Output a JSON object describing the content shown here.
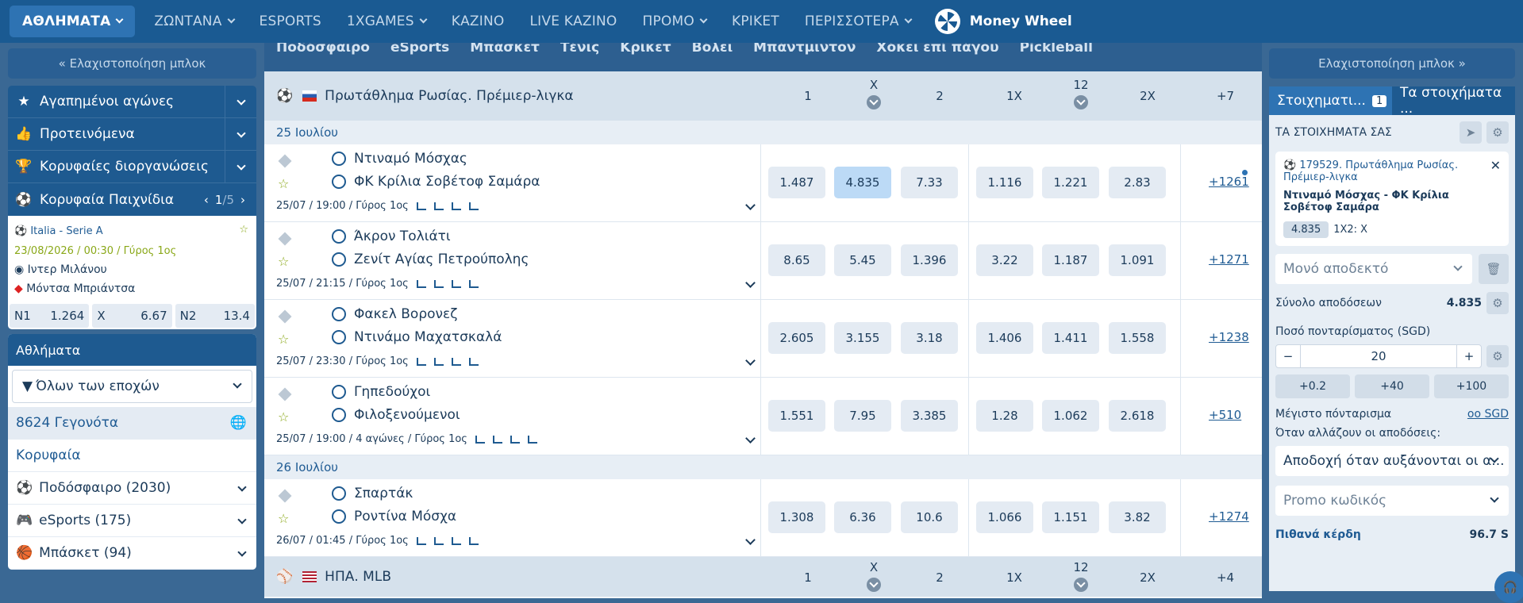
{
  "topnav": {
    "items": [
      {
        "label": "ΑΘΛΗΜΑΤΑ",
        "caret": true,
        "active": true
      },
      {
        "label": "ΖΩΝΤΑΝΑ",
        "caret": true
      },
      {
        "label": "ESPORTS"
      },
      {
        "label": "1XGAMES",
        "caret": true
      },
      {
        "label": "ΚΑΖΙΝΟ"
      },
      {
        "label": "LIVE ΚΑΖΙΝΟ"
      },
      {
        "label": "ΠΡΟΜΟ",
        "caret": true
      },
      {
        "label": "ΚΡΙΚΕΤ"
      },
      {
        "label": "ΠΕΡΙΣΣΟΤΕΡΑ",
        "caret": true
      }
    ],
    "money_wheel": "Money Wheel"
  },
  "left": {
    "minimize": "« Ελαχιστοποίηση μπλοκ",
    "nav": [
      {
        "label": "Αγαπημένοι αγώνες",
        "icon": "star-icon"
      },
      {
        "label": "Προτεινόμενα",
        "icon": "thumbs-up-icon"
      },
      {
        "label": "Κορυφαίες διοργανώσεις",
        "icon": "trophy-icon"
      }
    ],
    "top_games": {
      "label": "Κορυφαία Παιχνίδια",
      "page": "1",
      "pages": "/5"
    },
    "top_game": {
      "league": "Italia - Serie A",
      "datetime": "23/08/2026 / 00:30 / Γύρος 1ος",
      "team1": "Ιντερ Μιλάνου",
      "team2": "Μόντσα Μπριάντσα",
      "odds": [
        {
          "label": "N1",
          "value": "1.264"
        },
        {
          "label": "X",
          "value": "6.67"
        },
        {
          "label": "N2",
          "value": "13.4"
        }
      ]
    },
    "sports": {
      "header": "Αθλήματα",
      "season_select": "Όλων των εποχών",
      "events": "8624 Γεγονότα",
      "top": "Κορυφαία",
      "items": [
        {
          "label": "Ποδόσφαιρο (2030)",
          "icon": "soccer-icon"
        },
        {
          "label": "eSports (175)",
          "icon": "gamepad-icon"
        },
        {
          "label": "Μπάσκετ (94)",
          "icon": "basketball-icon"
        }
      ]
    }
  },
  "center": {
    "subnav": [
      "Ποδόσφαιρο",
      "eSports",
      "Μπάσκετ",
      "Τένις",
      "Κρίκετ",
      "Βόλεϊ",
      "Μπάντμιντον",
      "Χόκεϊ επί πάγου",
      "Pickleball"
    ],
    "league1": "Πρωτάθλημα Ρωσίας. Πρέμιερ-λιγκα",
    "league2": "ΗΠΑ. MLB",
    "columns": [
      "1",
      "X",
      "2",
      "1X",
      "12",
      "2X"
    ],
    "league1_more": "+7",
    "league2_more": "+4",
    "date1": "25 Ιουλίου",
    "date2": "26 Ιουλίου",
    "matches": [
      {
        "team1": "Ντιναμό Μόσχας",
        "team2": "ΦΚ Κρίλια Σοβέτοφ Σαμάρα",
        "meta": "25/07 / 19:00 / Γύρος 1ος",
        "odds": [
          "1.487",
          "4.835",
          "7.33",
          "1.116",
          "1.221",
          "2.83"
        ],
        "more": "+1261",
        "selected": 1
      },
      {
        "team1": "Άκρον Τολιάτι",
        "team2": "Ζενίτ Αγίας Πετρούπολης",
        "meta": "25/07 / 21:15 / Γύρος 1ος",
        "odds": [
          "8.65",
          "5.45",
          "1.396",
          "3.22",
          "1.187",
          "1.091"
        ],
        "more": "+1271"
      },
      {
        "team1": "Φακελ Βορονεζ",
        "team2": "Ντινάμο Μαχατσκαλά",
        "meta": "25/07 / 23:30 / Γύρος 1ος",
        "odds": [
          "2.605",
          "3.155",
          "3.18",
          "1.406",
          "1.411",
          "1.558"
        ],
        "more": "+1238"
      },
      {
        "team1": "Γηπεδούχοι",
        "team2": "Φιλοξενούμενοι",
        "meta": "25/07 / 19:00 / 4 αγώνες / Γύρος 1ος",
        "odds": [
          "1.551",
          "7.95",
          "3.385",
          "1.28",
          "1.062",
          "2.618"
        ],
        "more": "+510"
      },
      {
        "team1": "Σπαρτάκ",
        "team2": "Ροντίνα Μόσχα",
        "meta": "26/07 / 01:45 / Γύρος 1ος",
        "odds": [
          "1.308",
          "6.36",
          "10.6",
          "1.066",
          "1.151",
          "3.82"
        ],
        "more": "+1274"
      }
    ]
  },
  "right": {
    "minimize": "Ελαχιστοποίηση μπλοκ »",
    "tab1": "Στοιχηματι...",
    "tab1_count": "1",
    "tab2": "Τα στοιχήματα ...",
    "your_bets": "ΤΑ ΣΤΟΙΧΗΜΑΤΑ ΣΑΣ",
    "bet": {
      "event": "179529. Πρωτάθλημα Ρωσίας. Πρέμιερ-λιγκα",
      "match": "Ντιναμό Μόσχας - ΦΚ Κρίλια Σοβέτοφ Σαμάρα",
      "odd": "4.835",
      "pick": "1X2: X"
    },
    "bet_type": "Μονό αποδεκτό",
    "total_odds_label": "Σύνολο αποδόσεων",
    "total_odds": "4.835",
    "stake_label": "Ποσό πονταρίσματος (SGD)",
    "stake": "20",
    "quick": [
      "+0.2",
      "+40",
      "+100"
    ],
    "max_label": "Μέγιστο πόνταρισμα",
    "max_value": "oo SGD",
    "odds_change_label": "Όταν αλλάζουν οι αποδόσεις:",
    "odds_change": "Αποδοχή όταν αυξάνονται οι α...",
    "promo": "Promo κωδικός",
    "win_label": "Πιθανά κέρδη",
    "win_value": "96.7 S"
  }
}
